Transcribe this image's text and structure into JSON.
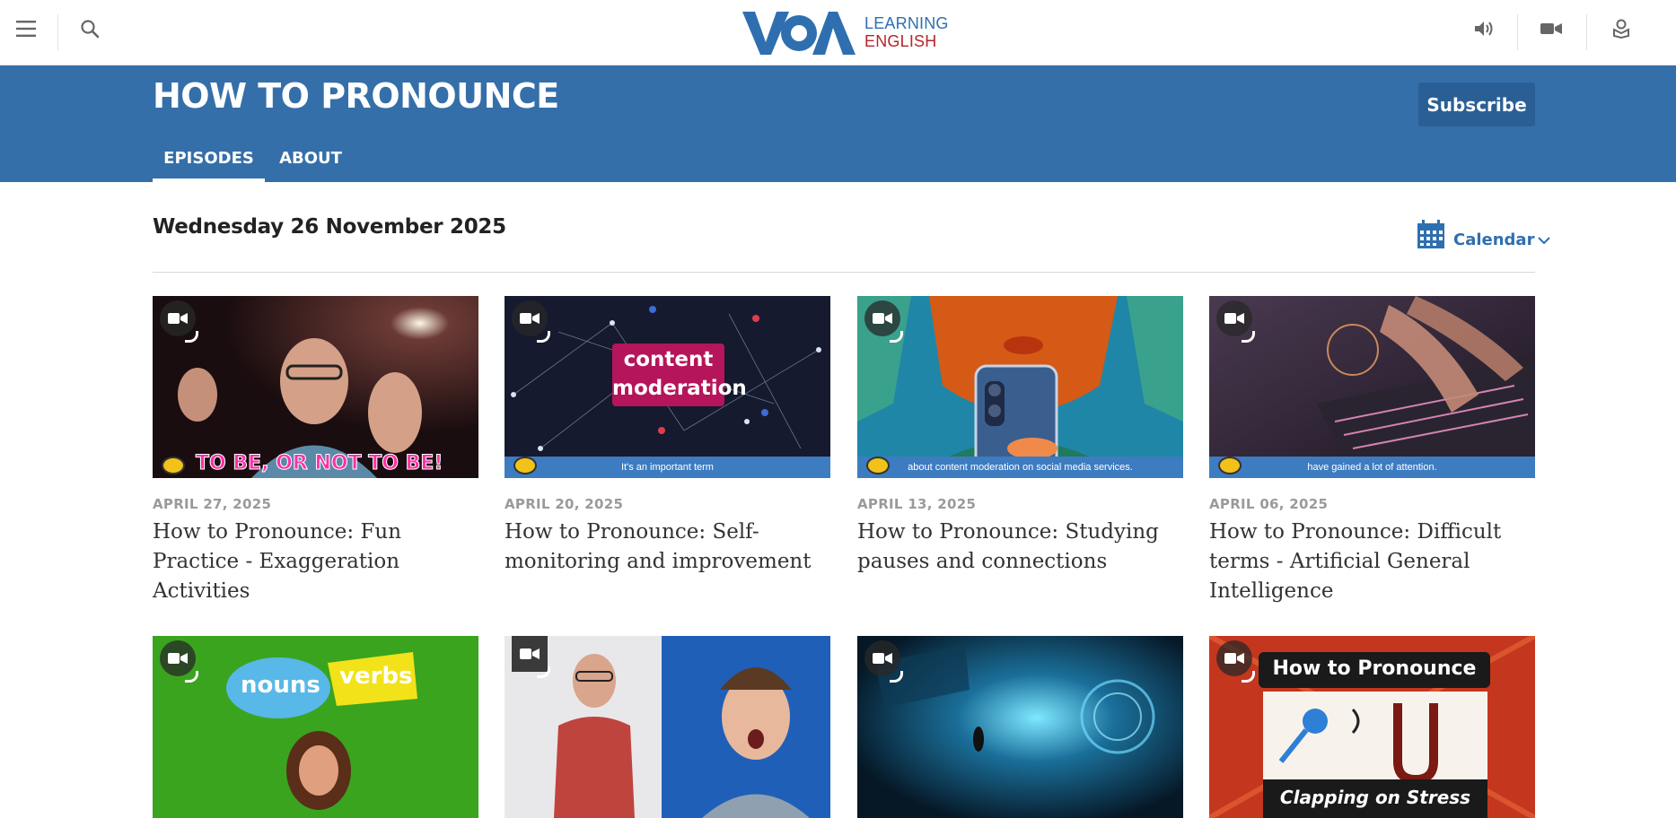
{
  "header": {
    "logo_mark": "VOA",
    "logo_line1": "LEARNING",
    "logo_line2": "ENGLISH"
  },
  "hero": {
    "title": "HOW TO PRONOUNCE",
    "subscribe_label": "Subscribe",
    "tabs": [
      {
        "label": "EPISODES",
        "active": true
      },
      {
        "label": "ABOUT",
        "active": false
      }
    ]
  },
  "date_heading": "Wednesday 26 November 2025",
  "calendar_label": "Calendar",
  "episodes": [
    {
      "date": "APRIL 27, 2025",
      "title": "How to Pronounce: Fun Practice - Exaggeration Activities",
      "overlay": "TO BE, OR NOT TO BE!",
      "caption": ""
    },
    {
      "date": "APRIL 20, 2025",
      "title": "How to Pronounce: Self-monitoring and improvement",
      "overlay": "content moderation",
      "caption": "It's an important term"
    },
    {
      "date": "APRIL 13, 2025",
      "title": "How to Pronounce: Studying pauses and connections",
      "overlay": "",
      "caption": "about content moderation on social media services."
    },
    {
      "date": "APRIL 06, 2025",
      "title": "How to Pronounce: Difficult terms - Artificial General Intelligence",
      "overlay": "",
      "caption": "have gained a lot of attention."
    }
  ],
  "row2": [
    {
      "overlay1": "nouns",
      "overlay2": "verbs"
    },
    {},
    {},
    {
      "overlay1": "How to Pronounce",
      "overlay2": "Clapping on Stress"
    }
  ],
  "colors": {
    "brand_blue": "#356fa9",
    "subscribe_bg": "#2a5f96",
    "logo_red": "#b5262b",
    "caption_blue": "#3d7cc0"
  },
  "icons": {
    "menu": "menu-icon",
    "search": "search-icon",
    "audio": "speaker-icon",
    "video": "video-camera-icon",
    "podcast": "podcast-icon",
    "calendar": "calendar-icon",
    "chevron": "chevron-down-icon",
    "media_badge": "video-badge-icon"
  }
}
